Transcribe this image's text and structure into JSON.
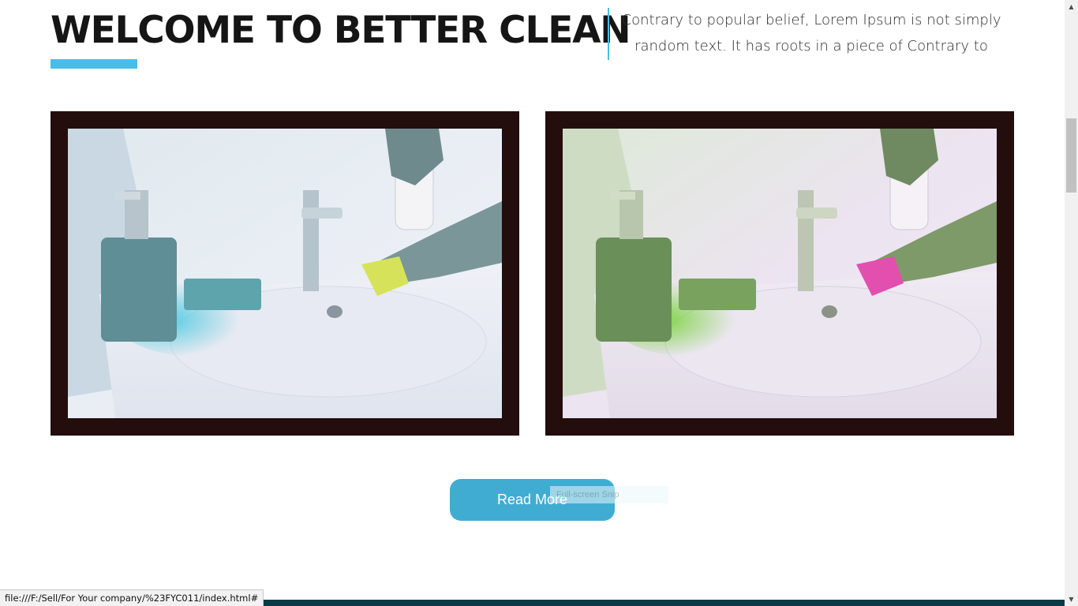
{
  "welcome": {
    "title": "WELCOME TO BETTER CLEAN",
    "intro": "Contrary to popular belief, Lorem Ipsum is not simply random text. It has roots in a piece of Contrary to"
  },
  "gallery": {
    "images": [
      {
        "label": "bathroom sink cleaning photo",
        "tint": "cyan"
      },
      {
        "label": "bathroom sink cleaning photo",
        "tint": "green-magenta"
      }
    ]
  },
  "cta": {
    "read_more_label": "Read More"
  },
  "overlay": {
    "snip_tooltip": "Full-screen Snip"
  },
  "browser": {
    "status_url": "file:///F:/Sell/For Your company/%23FYC011/index.html#"
  },
  "colors": {
    "accent": "#45bfe6",
    "button": "#41acd2",
    "frame": "#240d0d",
    "footer": "#0a3a46"
  }
}
